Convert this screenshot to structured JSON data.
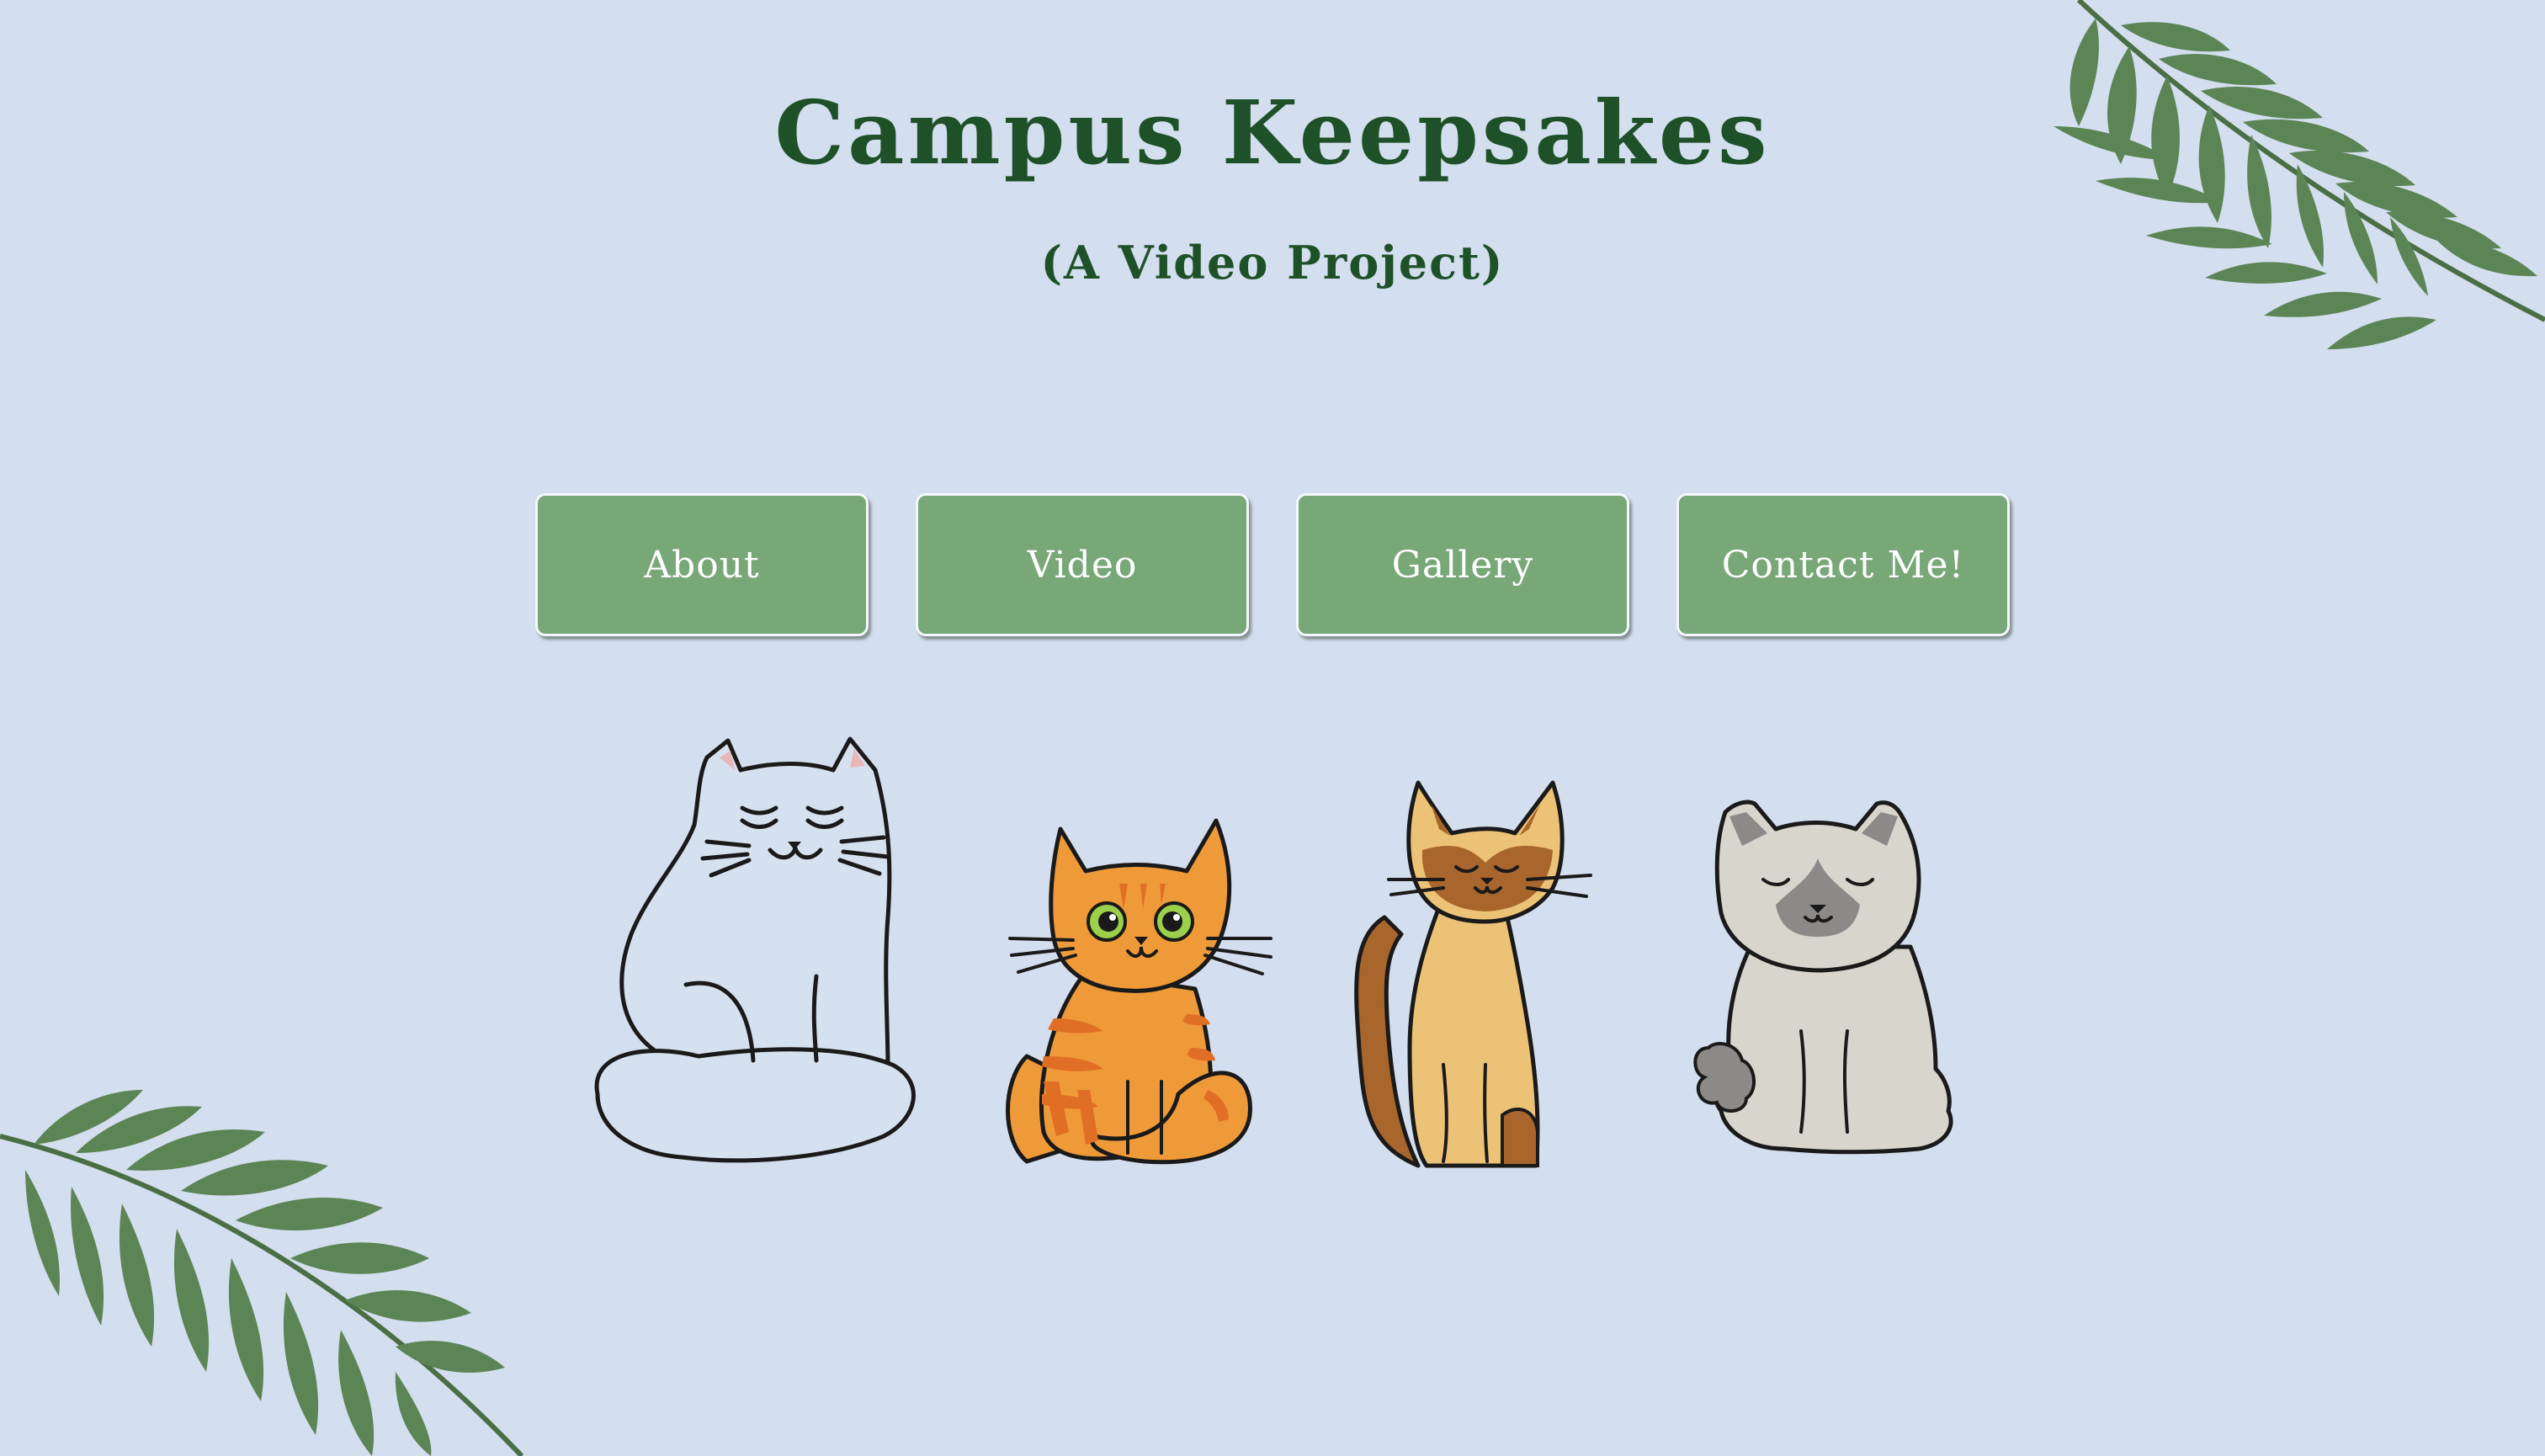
{
  "header": {
    "title": "Campus Keepsakes",
    "subtitle": "(A Video Project)"
  },
  "nav": {
    "items": [
      {
        "label": "About"
      },
      {
        "label": "Video"
      },
      {
        "label": "Gallery"
      },
      {
        "label": "Contact Me!"
      }
    ]
  },
  "colors": {
    "background": "#d3deee",
    "title": "#1f5129",
    "button": "#78a778",
    "button_text": "#ffffff",
    "leaf": "#4f7a4a"
  },
  "illustrations": {
    "leaves": [
      "fern-leaf-top-right",
      "fern-leaf-bottom-left"
    ],
    "cats": [
      "white-cat-illustration",
      "orange-tabby-cat-illustration",
      "siamese-cat-illustration",
      "fluffy-gray-cat-illustration"
    ]
  }
}
